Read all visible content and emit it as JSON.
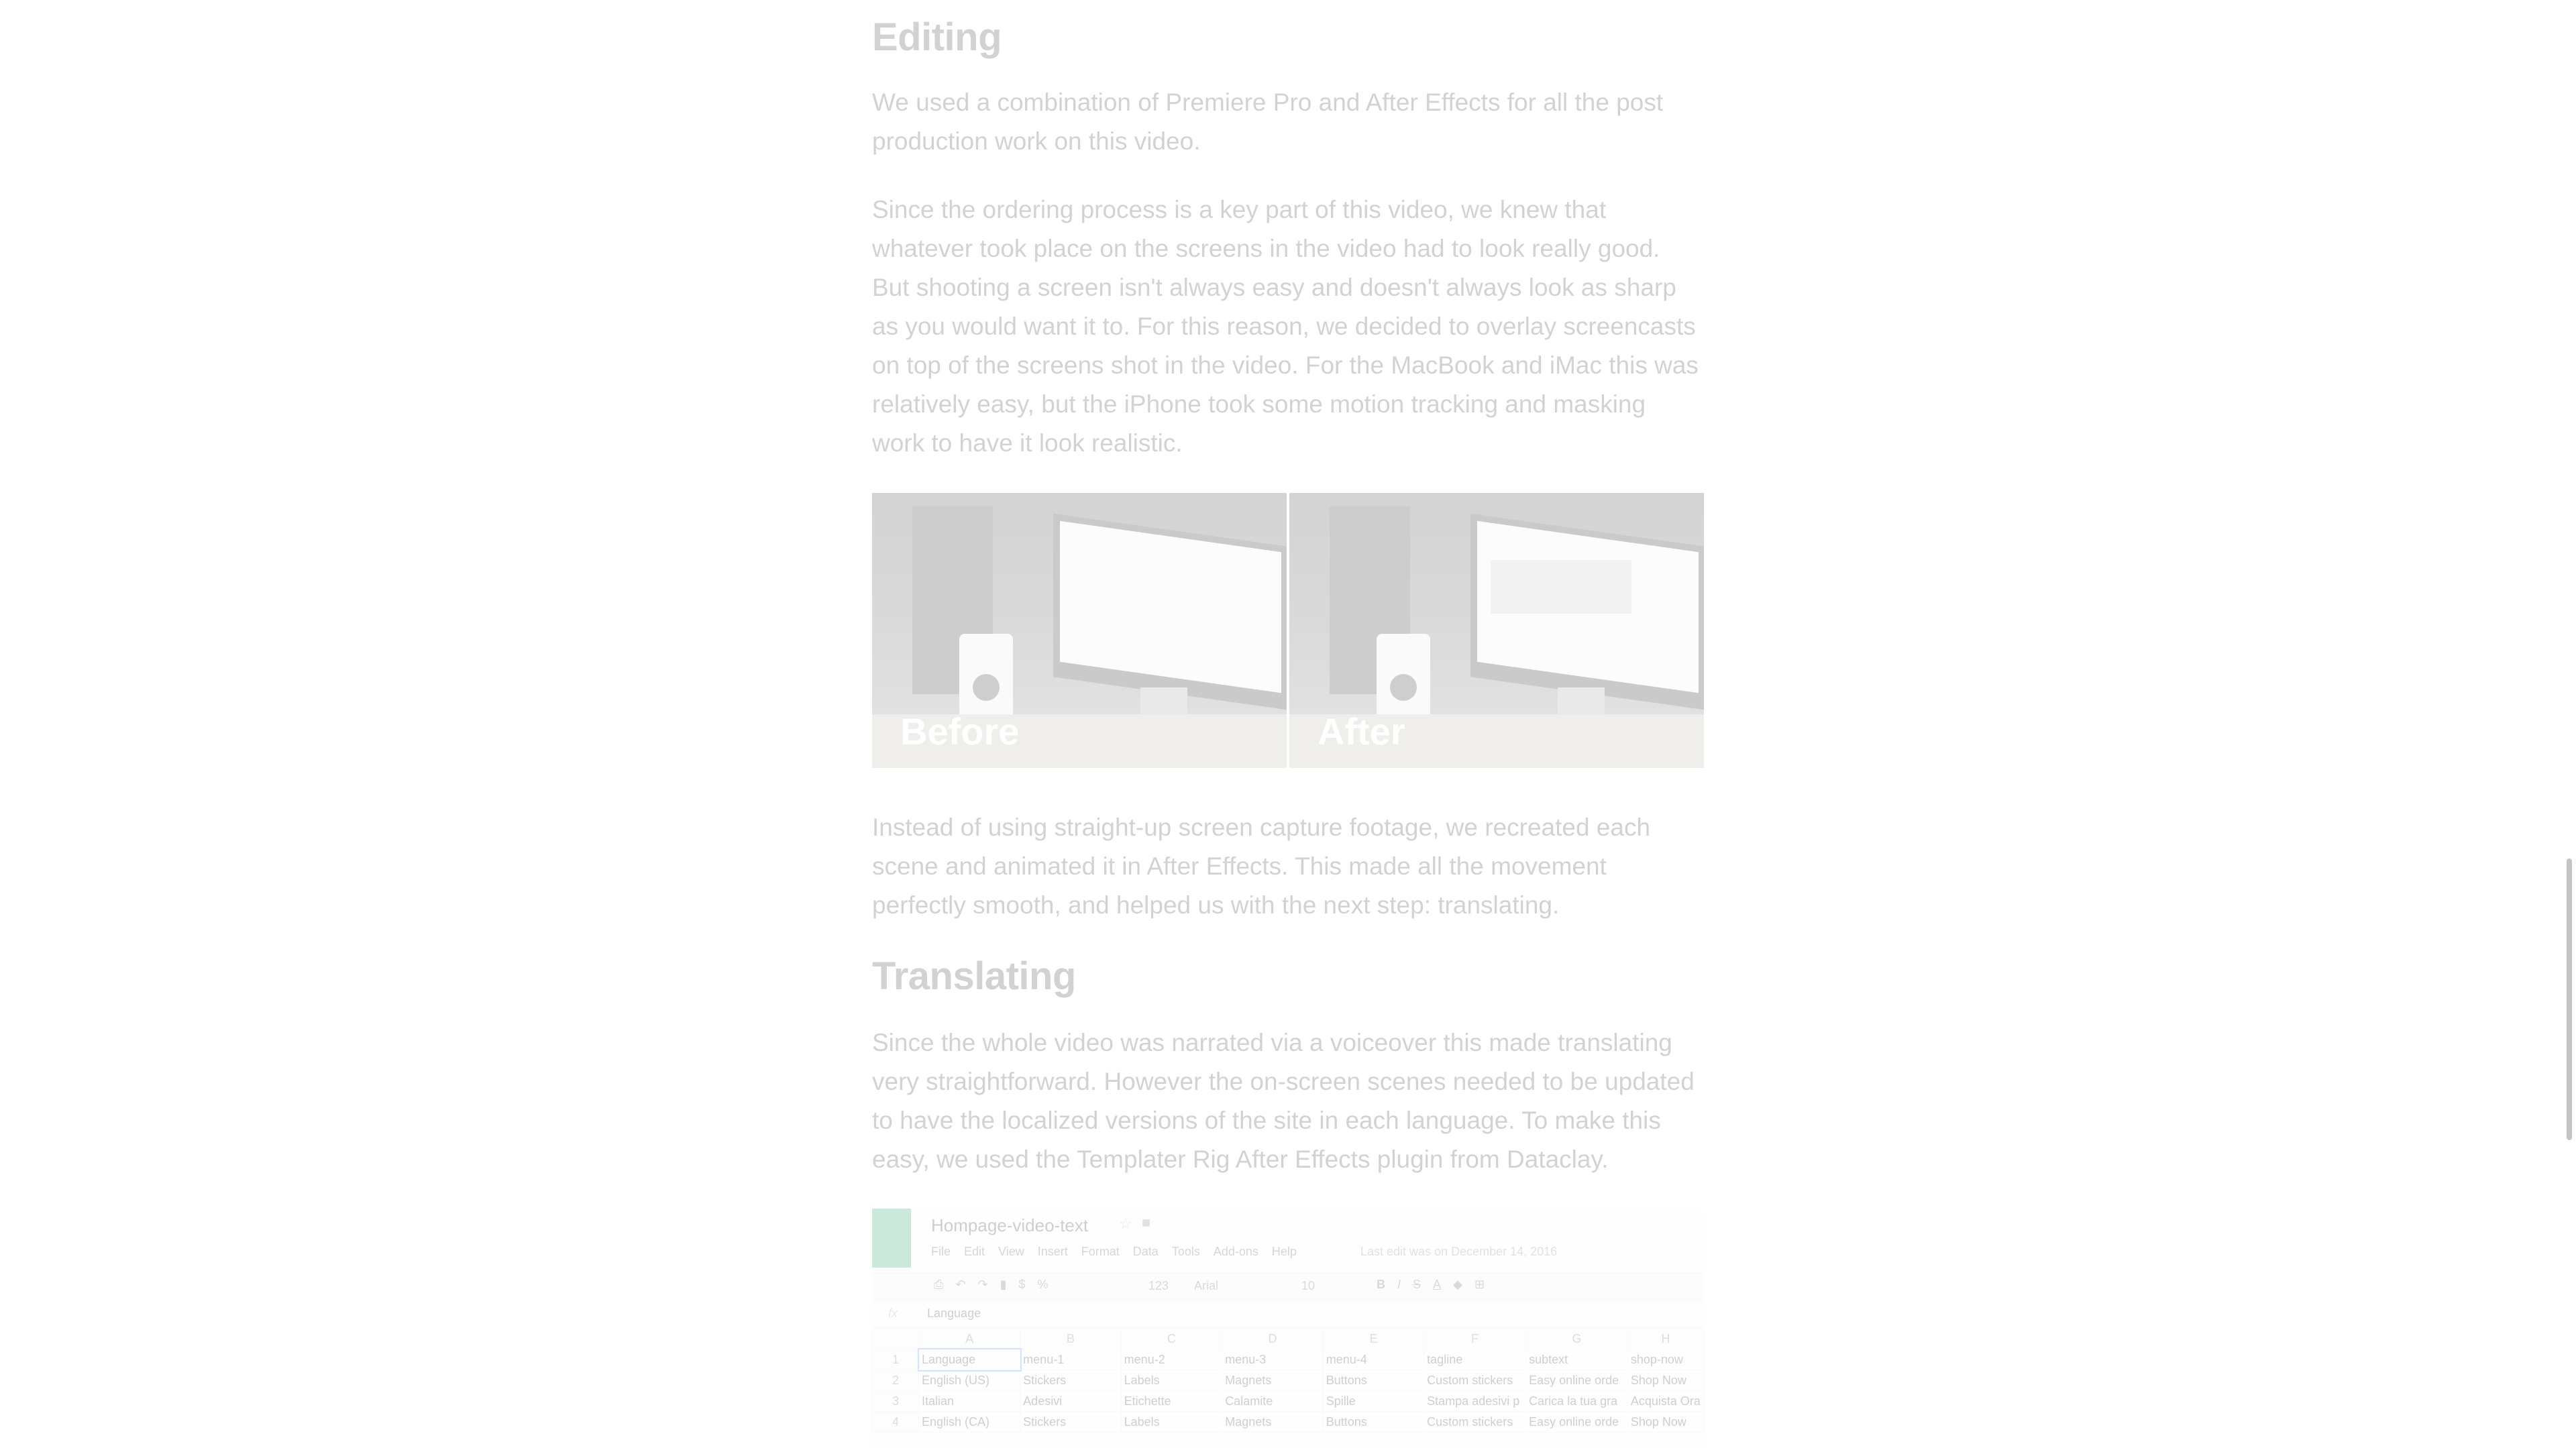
{
  "article": {
    "editing": {
      "heading": "Editing",
      "p1": "We used a combination of Premiere Pro and After Effects for all the post production work on this video.",
      "p2": "Since the ordering process is a key part of this video, we knew that whatever took place on the screens in the video had to look really good. But shooting a screen isn't always easy and doesn't always look as sharp as you would want it to. For this reason, we decided to overlay screencasts on top of the screens shot in the video. For the MacBook and iMac this was relatively easy, but the iPhone took some motion tracking and masking work to have it look realistic."
    },
    "comparison": {
      "before_label": "Before",
      "after_label": "After"
    },
    "after_figure_text": "Instead of using straight-up screen capture footage, we recreated each scene and animated it in After Effects. This made all the movement perfectly smooth, and helped us with the next step: translating.",
    "translating": {
      "heading": "Translating",
      "p1": "Since the whole video was narrated via a voiceover this made translating very straightforward. However the on-screen scenes needed to be updated to have the localized versions of the site in each language. To make this easy, we used the Templater Rig After Effects plugin from Dataclay."
    },
    "spreadsheet": {
      "title": "Hompage-video-text",
      "menu": [
        "File",
        "Edit",
        "View",
        "Insert",
        "Format",
        "Data",
        "Tools",
        "Add-ons",
        "Help"
      ],
      "last_edit": "Last edit was on December 14, 2016",
      "zoom": "123",
      "font_name": "Arial",
      "font_size": "10",
      "formula_label": "fx",
      "formula_value": "Language",
      "columns": [
        "A",
        "B",
        "C",
        "D",
        "E",
        "F",
        "G",
        "H"
      ],
      "rows": [
        {
          "n": "1",
          "cells": [
            "Language",
            "menu-1",
            "menu-2",
            "menu-3",
            "menu-4",
            "tagline",
            "subtext",
            "shop-now"
          ]
        },
        {
          "n": "2",
          "cells": [
            "English (US)",
            "Stickers",
            "Labels",
            "Magnets",
            "Buttons",
            "Custom stickers",
            "Easy online orde",
            "Shop Now"
          ]
        },
        {
          "n": "3",
          "cells": [
            "Italian",
            "Adesivi",
            "Etichette",
            "Calamite",
            "Spille",
            "Stampa adesivi p",
            "Carica la tua gra",
            "Acquista Ora"
          ]
        },
        {
          "n": "4",
          "cells": [
            "English (CA)",
            "Stickers",
            "Labels",
            "Magnets",
            "Buttons",
            "Custom stickers",
            "Easy online orde",
            "Shop Now"
          ]
        }
      ]
    }
  },
  "colors": {
    "text": "#333333",
    "sheet_green": "#0f9d58",
    "scroll_thumb": "#c4c4c4"
  }
}
